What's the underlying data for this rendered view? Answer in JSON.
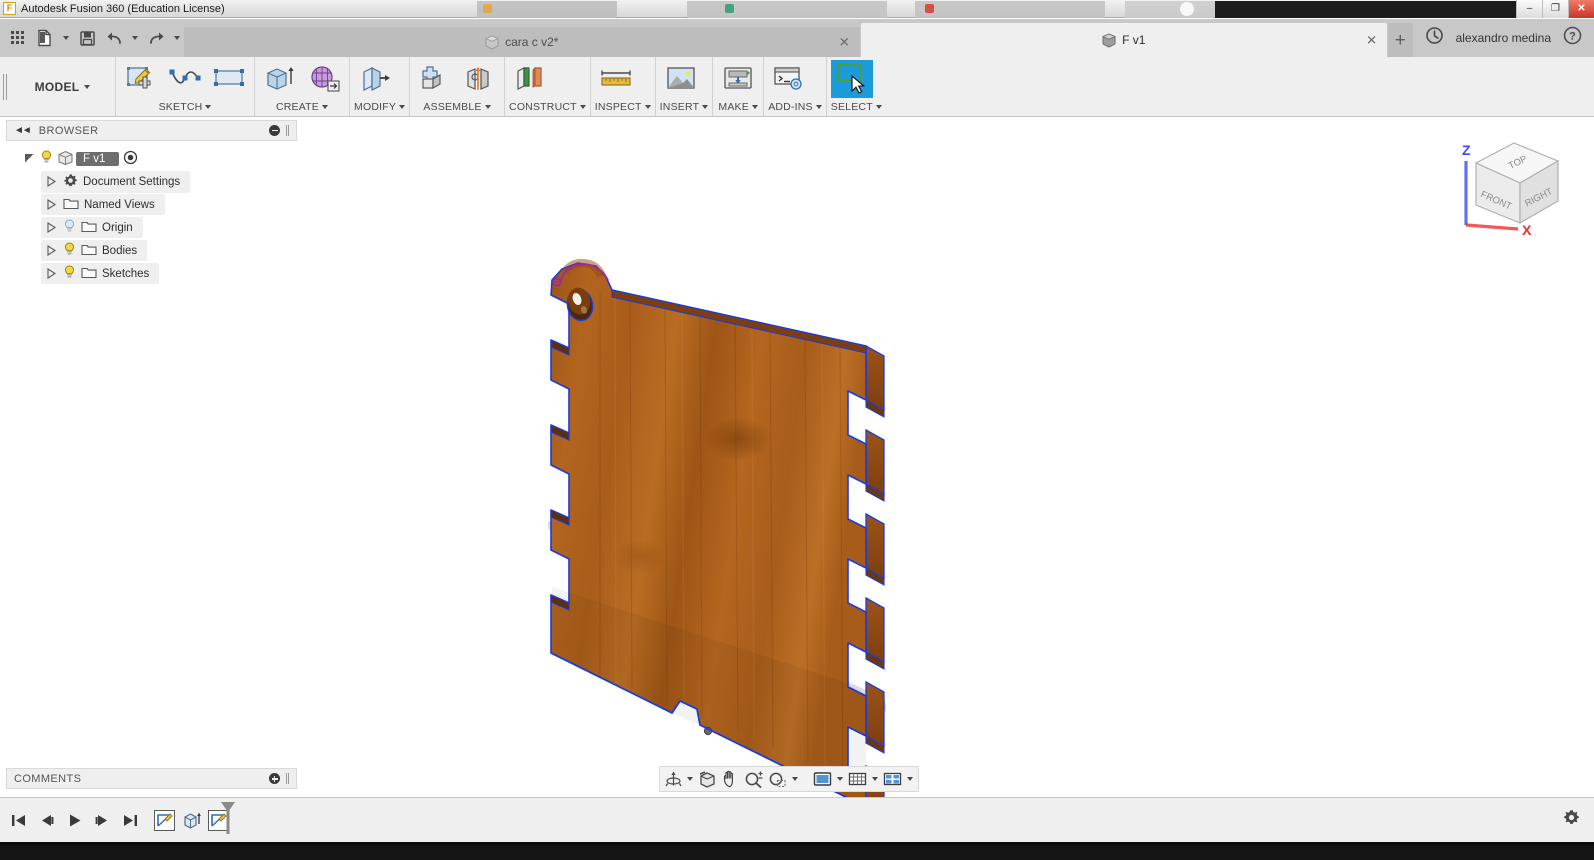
{
  "window": {
    "app_title": "Autodesk Fusion 360 (Education License)",
    "app_icon": "fusion-logo-icon",
    "minimize_label": "–",
    "maximize_label": "❐",
    "close_label": "✕"
  },
  "quick_access": {
    "items": [
      {
        "name": "app-grid-button",
        "icon": "grid-icon",
        "label": ""
      },
      {
        "name": "new-file-button",
        "icon": "file-new-icon",
        "label": ""
      },
      {
        "name": "new-file-dropdown",
        "icon": "caret-down-icon",
        "label": ""
      },
      {
        "name": "save-button",
        "icon": "save-disk-icon",
        "label": ""
      },
      {
        "name": "undo-button",
        "icon": "undo-arrow-icon",
        "label": ""
      },
      {
        "name": "undo-dropdown",
        "icon": "caret-down-icon",
        "label": ""
      },
      {
        "name": "redo-button",
        "icon": "redo-arrow-icon",
        "label": ""
      },
      {
        "name": "redo-dropdown",
        "icon": "caret-down-icon",
        "label": ""
      }
    ]
  },
  "tabs": [
    {
      "label": "cara c v2*",
      "icon": "document-cube-icon",
      "close": "✕",
      "active": false
    },
    {
      "label": "F v1",
      "icon": "document-cube-icon",
      "close": "✕",
      "active": true
    }
  ],
  "tab_bar_right": {
    "new_tab": "+",
    "history_icon": "clock-history-icon",
    "username": "alexandro medina",
    "help_icon": "help-question-icon"
  },
  "ribbon": {
    "workspace": {
      "label": "MODEL",
      "caret": "▾"
    },
    "groups": [
      {
        "label": "SKETCH",
        "caret": "▾",
        "name": "ribbon-group-sketch",
        "tools": [
          {
            "name": "create-sketch-tool",
            "icon": "sketch-pencil-icon"
          },
          {
            "name": "spline-tool",
            "icon": "spline-curve-icon"
          },
          {
            "name": "rectangle-tool",
            "icon": "rectangle-icon"
          }
        ]
      },
      {
        "label": "CREATE",
        "caret": "▾",
        "name": "ribbon-group-create",
        "tools": [
          {
            "name": "extrude-tool",
            "icon": "extrude-icon"
          },
          {
            "name": "create-mesh-tool",
            "icon": "mesh-grid-icon"
          }
        ]
      },
      {
        "label": "MODIFY",
        "caret": "▾",
        "name": "ribbon-group-modify",
        "tools": [
          {
            "name": "press-pull-tool",
            "icon": "press-pull-icon"
          }
        ]
      },
      {
        "label": "ASSEMBLE",
        "caret": "▾",
        "name": "ribbon-group-assemble",
        "tools": [
          {
            "name": "new-component-tool",
            "icon": "new-component-icon"
          },
          {
            "name": "joint-tool",
            "icon": "joint-icon"
          }
        ]
      },
      {
        "label": "CONSTRUCT",
        "caret": "▾",
        "name": "ribbon-group-construct",
        "tools": [
          {
            "name": "offset-plane-tool",
            "icon": "offset-plane-icon"
          }
        ]
      },
      {
        "label": "INSPECT",
        "caret": "▾",
        "name": "ribbon-group-inspect",
        "tools": [
          {
            "name": "measure-tool",
            "icon": "ruler-measure-icon"
          }
        ]
      },
      {
        "label": "INSERT",
        "caret": "▾",
        "name": "ribbon-group-insert",
        "tools": [
          {
            "name": "insert-image-tool",
            "icon": "picture-mountain-icon"
          }
        ]
      },
      {
        "label": "MAKE",
        "caret": "▾",
        "name": "ribbon-group-make",
        "tools": [
          {
            "name": "3d-print-tool",
            "icon": "3d-printer-icon"
          }
        ]
      },
      {
        "label": "ADD-INS",
        "caret": "▾",
        "name": "ribbon-group-addins",
        "tools": [
          {
            "name": "scripts-addins-tool",
            "icon": "console-gear-icon"
          }
        ]
      },
      {
        "label": "SELECT",
        "caret": "▾",
        "name": "ribbon-group-select",
        "selected": true,
        "tools": [
          {
            "name": "select-tool",
            "icon": "select-arrow-icon"
          }
        ]
      }
    ]
  },
  "browser": {
    "title": "BROWSER",
    "collapse_icon": "collapse-left-arrows-icon",
    "minimize_icon": "minus-circle-icon",
    "tree": [
      {
        "label": "F v1",
        "name": "browser-node-root",
        "indent": 0,
        "expanded": true,
        "selected": true,
        "bulb": "on",
        "icon": "component-cube-icon",
        "radio": true
      },
      {
        "label": "Document Settings",
        "name": "browser-node-document-settings",
        "indent": 1,
        "expanded": false,
        "selected": false,
        "bulb": "none",
        "icon": "gear-icon",
        "radio": false
      },
      {
        "label": "Named Views",
        "name": "browser-node-named-views",
        "indent": 1,
        "expanded": false,
        "selected": false,
        "bulb": "none",
        "icon": "folder-icon",
        "radio": false
      },
      {
        "label": "Origin",
        "name": "browser-node-origin",
        "indent": 1,
        "expanded": false,
        "selected": false,
        "bulb": "off",
        "icon": "folder-icon",
        "radio": false
      },
      {
        "label": "Bodies",
        "name": "browser-node-bodies",
        "indent": 1,
        "expanded": false,
        "selected": false,
        "bulb": "on",
        "icon": "folder-icon",
        "radio": false
      },
      {
        "label": "Sketches",
        "name": "browser-node-sketches",
        "indent": 1,
        "expanded": false,
        "selected": false,
        "bulb": "on",
        "icon": "folder-icon",
        "radio": false
      }
    ]
  },
  "comments": {
    "title": "COMMENTS",
    "add_icon": "plus-circle-icon"
  },
  "viewcube": {
    "top_face": "TOP",
    "front_face": "FRONT",
    "right_face": "RIGHT",
    "z_axis": "Z",
    "x_axis": "X",
    "z_color": "#3b4cf0",
    "x_color": "#ee2f2f"
  },
  "navigation_bar": {
    "items": [
      {
        "name": "orbit-button",
        "icon": "orbit-icon",
        "dropdown": true
      },
      {
        "name": "look-at-button",
        "icon": "look-at-icon",
        "dropdown": false
      },
      {
        "name": "pan-button",
        "icon": "pan-hand-icon",
        "dropdown": false
      },
      {
        "name": "zoom-button",
        "icon": "zoom-magnifier-icon",
        "dropdown": false
      },
      {
        "name": "fit-button",
        "icon": "fit-window-icon",
        "dropdown": true
      },
      {
        "name": "display-settings-button",
        "icon": "display-screen-icon",
        "dropdown": true
      },
      {
        "name": "grid-snaps-button",
        "icon": "grid-snap-icon",
        "dropdown": true
      },
      {
        "name": "viewports-button",
        "icon": "viewports-icon",
        "dropdown": true
      }
    ]
  },
  "timeline": {
    "playback": [
      {
        "name": "timeline-go-to-beginning",
        "icon": "skip-to-start-icon"
      },
      {
        "name": "timeline-step-back",
        "icon": "step-back-icon"
      },
      {
        "name": "timeline-play",
        "icon": "play-icon"
      },
      {
        "name": "timeline-step-forward",
        "icon": "step-forward-icon"
      },
      {
        "name": "timeline-go-to-end",
        "icon": "skip-to-end-icon"
      }
    ],
    "features": [
      {
        "name": "timeline-feature-sketch-1",
        "icon": "sketch-feature-icon"
      },
      {
        "name": "timeline-feature-extrude",
        "icon": "extrude-feature-icon"
      },
      {
        "name": "timeline-feature-sketch-2",
        "icon": "sketch-feature-icon"
      }
    ],
    "marker_icon": "timeline-playhead-icon",
    "settings_icon": "gear-icon"
  },
  "model": {
    "body_color": "#b5651d",
    "body_color_dark": "#8a4a12",
    "sketch_edge_color": "#1a3be0",
    "arc_color": "#a02a9a",
    "shadow_color": "#d8d8d8",
    "description": "wooden finger-jointed panel with hanging hole"
  }
}
